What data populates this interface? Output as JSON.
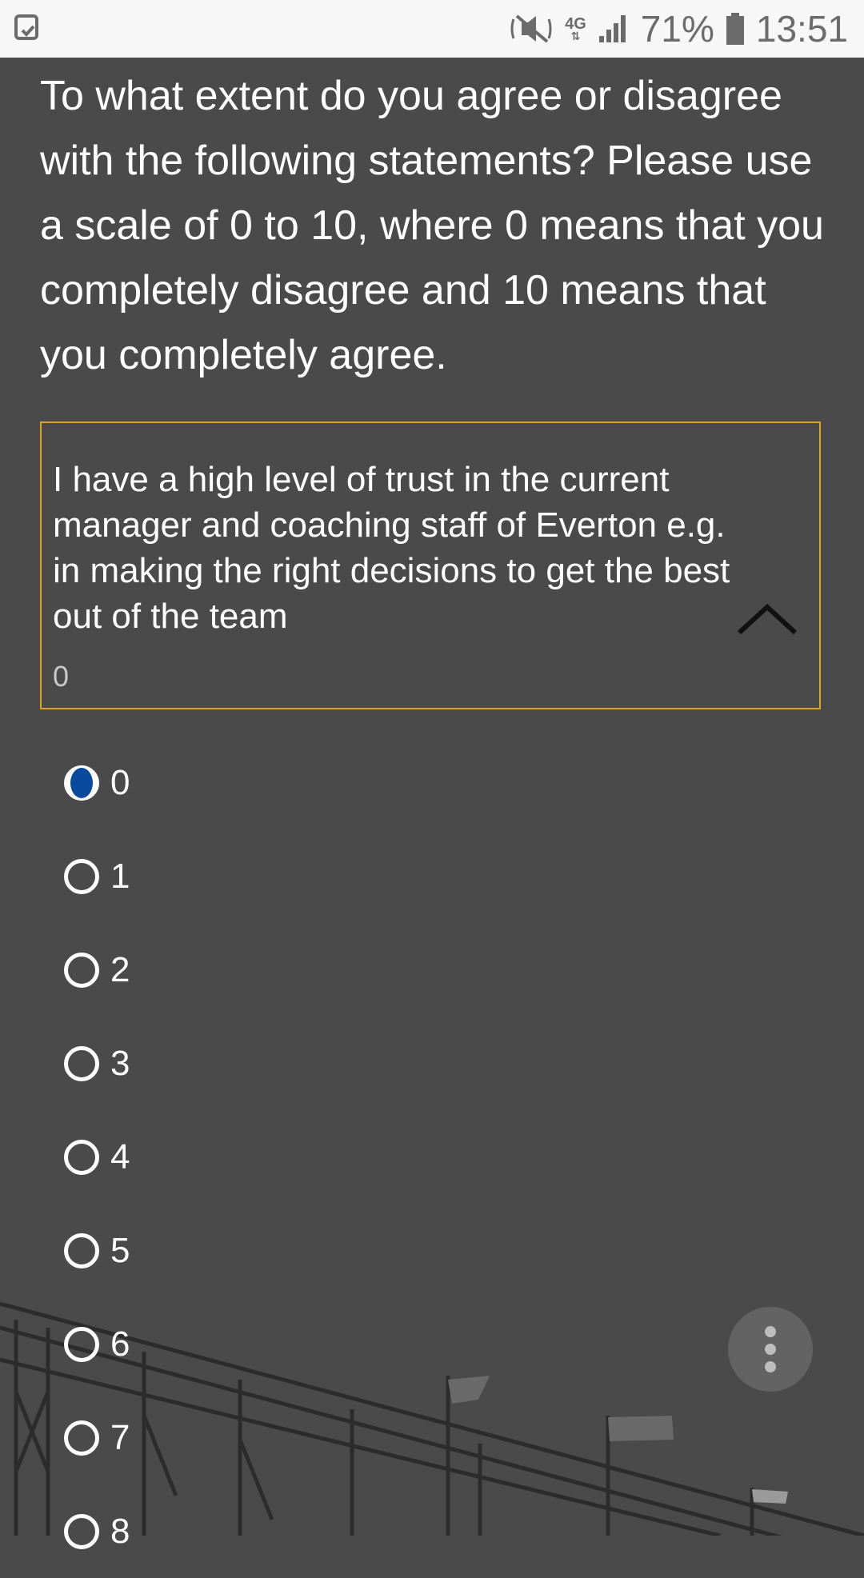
{
  "status_bar": {
    "battery_percent": "71%",
    "time": "13:51",
    "network": "4G",
    "icons": [
      "notification-icon",
      "mute-icon",
      "network-4g-icon",
      "signal-icon",
      "battery-icon"
    ]
  },
  "survey": {
    "question": "To what extent do you agree or disagree with the following statements? Please use a scale of 0 to 10, where 0 means that you completely disagree and 10 means that you completely agree.",
    "statement": "I have a high level of trust in the current manager and coaching staff of Everton e.g. in making the right decisions to get the best out of the team",
    "selected_value": "0",
    "options": [
      "0",
      "1",
      "2",
      "3",
      "4",
      "5",
      "6",
      "7",
      "8"
    ],
    "selected_index": 0
  },
  "colors": {
    "background": "#4a4a4a",
    "accent_border": "#e0a020",
    "radio_selected": "#0a4a9e"
  }
}
